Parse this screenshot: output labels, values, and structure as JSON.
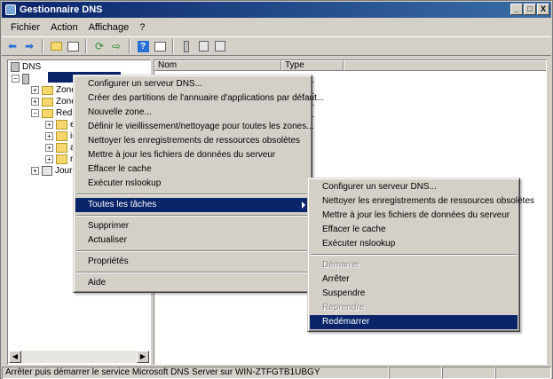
{
  "window": {
    "title": "Gestionnaire DNS",
    "controls": [
      "_",
      "□",
      "X"
    ]
  },
  "menubar": [
    "Fichier",
    "Action",
    "Affichage",
    "?"
  ],
  "toolbar_icons": [
    "back-arrow-icon",
    "forward-arrow-icon",
    "up-folder-icon",
    "show-hide-tree-icon",
    "refresh-icon",
    "export-icon",
    "help-icon",
    "properties-icon",
    "dns-zone-icon",
    "record-icon",
    "list-view-icon"
  ],
  "tree": {
    "root": "DNS",
    "items": [
      {
        "label": "Zone"
      },
      {
        "label": "Zone"
      },
      {
        "label": "Redir"
      },
      {
        "label": "e"
      },
      {
        "label": "ic"
      },
      {
        "label": "a"
      },
      {
        "label": "n"
      },
      {
        "label": "Journ"
      }
    ]
  },
  "list": {
    "columns": [
      "Nom",
      "Type"
    ],
    "rows": [
      {
        "type": "teur c..."
      },
      {
        "type": "teur c..."
      },
      {
        "type": "teur c..."
      },
      {
        "type": "teur c..."
      }
    ]
  },
  "context_menu": {
    "group1": [
      "Configurer un serveur DNS...",
      "Créer des partitions de l'annuaire d'applications par défaut...",
      "Nouvelle zone...",
      "Définir le vieillissement/nettoyage pour toutes les zones...",
      "Nettoyer les enregistrements de ressources obsolètes",
      "Mettre à jour les fichiers de données du serveur",
      "Effacer le cache",
      "Exécuter nslookup"
    ],
    "all_tasks": "Toutes les tâches",
    "group3": [
      "Supprimer",
      "Actualiser"
    ],
    "properties": "Propriétés",
    "help": "Aide"
  },
  "submenu": {
    "group1": [
      "Configurer un serveur DNS...",
      "Nettoyer les enregistrements de ressources obsolètes",
      "Mettre à jour les fichiers de données du serveur",
      "Effacer le cache",
      "Exécuter nslookup"
    ],
    "start": "Démarrer",
    "stop": "Arrêter",
    "suspend": "Suspendre",
    "resume": "Reprendre",
    "restart": "Redémarrer"
  },
  "statusbar": {
    "text": "Arrêter puis démarrer le service Microsoft DNS Server sur WIN-ZTFGTB1UBGY"
  }
}
